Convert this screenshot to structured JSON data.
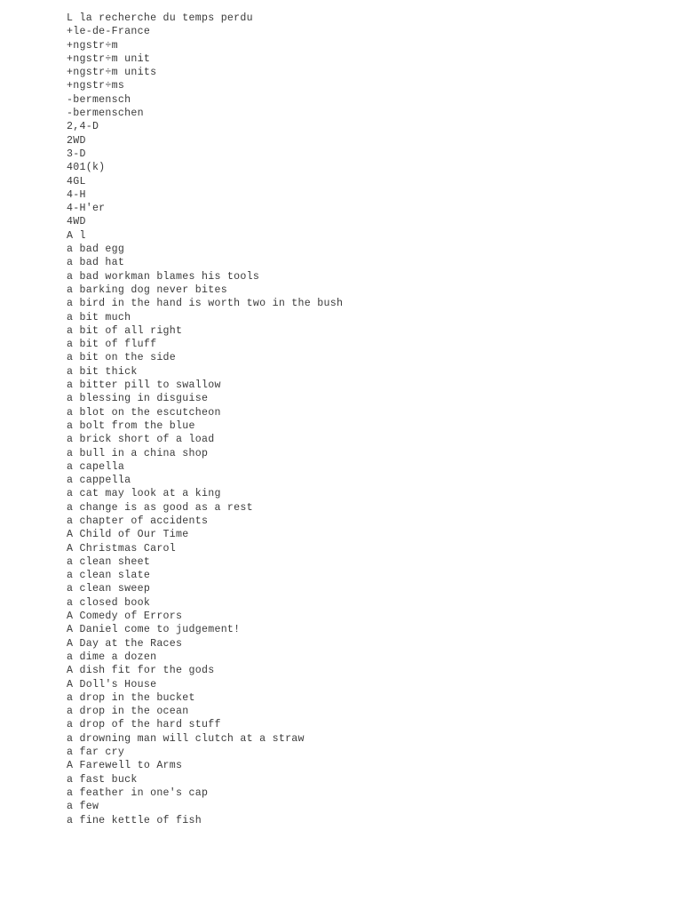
{
  "document": {
    "background_color": "#ffffff",
    "text_color": "#3a3a3a",
    "page_number_visible": false,
    "lines": [
      {
        "text": "L la recherche du temps perdu"
      },
      {
        "text": "+le-de-France"
      },
      {
        "text": "+ngstr÷m"
      },
      {
        "text": "+ngstr÷m unit"
      },
      {
        "text": "+ngstr÷m units"
      },
      {
        "text": "+ngstr÷ms"
      },
      {
        "text": "-bermensch"
      },
      {
        "text": "-bermenschen"
      },
      {
        "text": "2,4-D"
      },
      {
        "text": "2WD"
      },
      {
        "text": "3-D"
      },
      {
        "text": "401(k)"
      },
      {
        "text": "4GL"
      },
      {
        "text": "4-H"
      },
      {
        "text": "4-H'er"
      },
      {
        "text": "4WD"
      },
      {
        "text": "A l"
      },
      {
        "text": "a bad egg"
      },
      {
        "text": "a bad hat"
      },
      {
        "text": "a bad workman blames his tools"
      },
      {
        "text": "a barking dog never bites"
      },
      {
        "text": "a bird in the hand is worth two in the bush"
      },
      {
        "text": "a bit much"
      },
      {
        "text": "a bit of all right"
      },
      {
        "text": "a bit of fluff"
      },
      {
        "text": "a bit on the side"
      },
      {
        "text": "a bit thick"
      },
      {
        "text": "a bitter pill to swallow"
      },
      {
        "text": "a blessing in disguise"
      },
      {
        "text": "a blot on the escutcheon"
      },
      {
        "text": "a bolt from the blue"
      },
      {
        "text": "a brick short of a load"
      },
      {
        "text": "a bull in a china shop"
      },
      {
        "text": "a capella"
      },
      {
        "text": "a cappella"
      },
      {
        "text": "a cat may look at a king"
      },
      {
        "text": "a change is as good as a rest"
      },
      {
        "text": "a chapter of accidents"
      },
      {
        "text": "A Child of Our Time"
      },
      {
        "text": "A Christmas Carol"
      },
      {
        "text": "a clean sheet"
      },
      {
        "text": "a clean slate"
      },
      {
        "text": "a clean sweep"
      },
      {
        "text": "a closed book"
      },
      {
        "text": "A Comedy of Errors"
      },
      {
        "text": "A Daniel come to judgement!"
      },
      {
        "text": "A Day at the Races"
      },
      {
        "text": "a dime a dozen"
      },
      {
        "text": "A dish fit for the gods"
      },
      {
        "text": "A Doll's House"
      },
      {
        "text": "a drop in the bucket"
      },
      {
        "text": "a drop in the ocean"
      },
      {
        "text": "a drop of the hard stuff"
      },
      {
        "text": "a drowning man will clutch at a straw"
      },
      {
        "text": "a far cry"
      },
      {
        "text": "A Farewell to Arms"
      },
      {
        "text": "a fast buck"
      },
      {
        "text": "a feather in one's cap"
      },
      {
        "text": "a few"
      },
      {
        "text": "a fine kettle of fish"
      }
    ]
  }
}
